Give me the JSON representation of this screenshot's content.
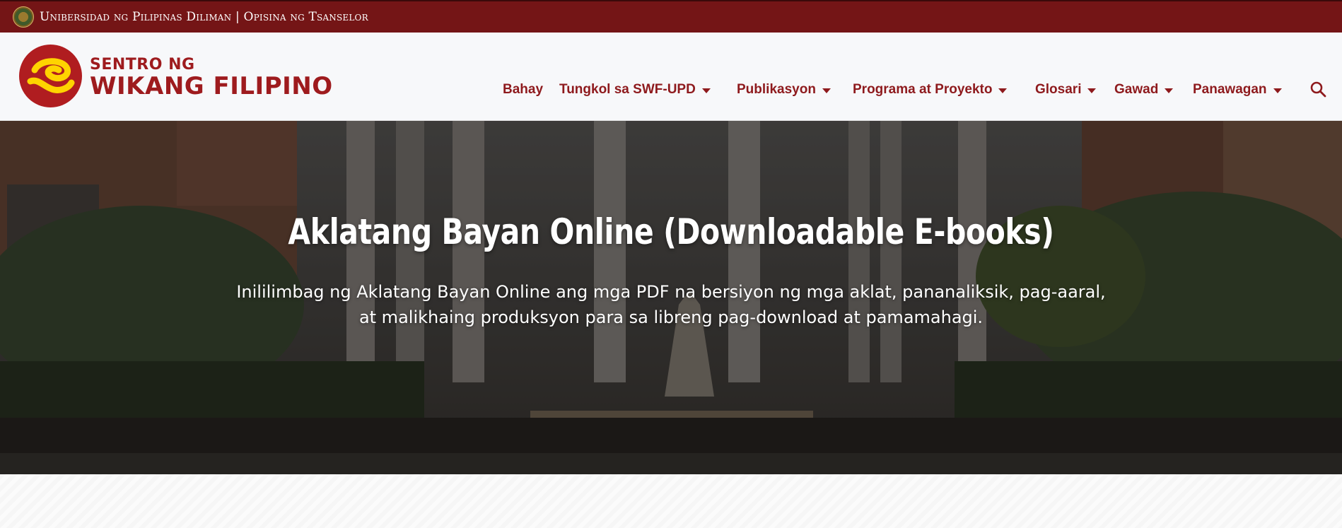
{
  "topbar": {
    "text": "Unibersidad ng Pilipinas Diliman | Opisina ng Tsanselor",
    "seal_icon": "up-seal-icon"
  },
  "logo": {
    "top_text": "SENTRO NG",
    "bottom_text": "WIKANG FILIPINO",
    "colors": {
      "primary": "#b01d20",
      "accent": "#ffd400"
    }
  },
  "nav": {
    "items": [
      {
        "label": "Bahay",
        "dropdown": false
      },
      {
        "label": "Tungkol sa SWF-UPD",
        "dropdown": true
      },
      {
        "label": "Publikasyon",
        "dropdown": true
      },
      {
        "label": "Programa at Proyekto",
        "dropdown": true
      },
      {
        "label": "Glosari",
        "dropdown": true
      },
      {
        "label": "Gawad",
        "dropdown": true
      },
      {
        "label": "Panawagan",
        "dropdown": true
      }
    ],
    "search_icon": "search-icon"
  },
  "hero": {
    "title": "Aklatang Bayan Online (Downloadable E-books)",
    "subtitle_line1": "Inililimbag ng Aklatang Bayan Online ang mga PDF na bersiyon ng mga aklat, pananaliksik, pag-aaral,",
    "subtitle_line2": "at malikhaing produksyon para sa libreng pag-download at pamamahagi."
  },
  "colors": {
    "topbar": "#741516",
    "nav_text": "#8e1a1d",
    "header_bg": "#f7f8fa"
  }
}
